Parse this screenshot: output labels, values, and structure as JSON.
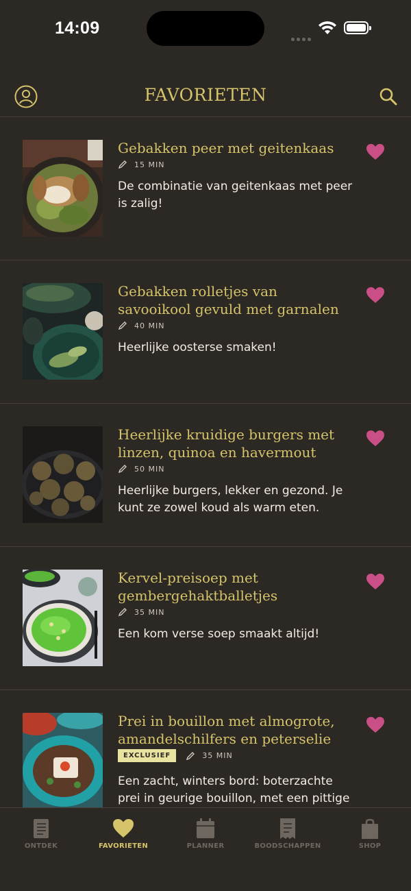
{
  "status": {
    "time": "14:09"
  },
  "header": {
    "title": "FAVORIETEN"
  },
  "recipes": [
    {
      "title": "Gebakken peer met geitenkaas",
      "time": "15 MIN",
      "badge": "",
      "description": "De combinatie van geitenkaas met peer is zalig!"
    },
    {
      "title": "Gebakken rolletjes van savooikool gevuld met garnalen",
      "time": "40 MIN",
      "badge": "",
      "description": "Heerlijke oosterse smaken!"
    },
    {
      "title": "Heerlijke kruidige burgers met linzen, quinoa en havermout",
      "time": "50 MIN",
      "badge": "",
      "description": "Heerlijke burgers, lekker en gezond. Je kunt ze zowel koud als warm eten."
    },
    {
      "title": "Kervel-preisoep met gembergehaktballetjes",
      "time": "35 MIN",
      "badge": "",
      "description": "Een kom verse soep smaakt altijd!"
    },
    {
      "title": "Prei in bouillon met almogrote, amandelschilfers en peterselie",
      "time": "35 MIN",
      "badge": "EXCLUSIEF",
      "description": "Een zacht, winters bord: boterzachte prei in geurige bouillon, met een pittige"
    }
  ],
  "tabs": [
    {
      "label": "ONTDEK",
      "icon": "book-icon"
    },
    {
      "label": "FAVORIETEN",
      "icon": "heart-icon"
    },
    {
      "label": "PLANNER",
      "icon": "calendar-icon"
    },
    {
      "label": "BOODSCHAPPEN",
      "icon": "receipt-icon"
    },
    {
      "label": "SHOP",
      "icon": "shopping-bag-icon"
    }
  ],
  "colors": {
    "accent": "#d6c46a",
    "favorite": "#c94f86",
    "background": "#2c2824",
    "inactive": "#6d675f"
  }
}
